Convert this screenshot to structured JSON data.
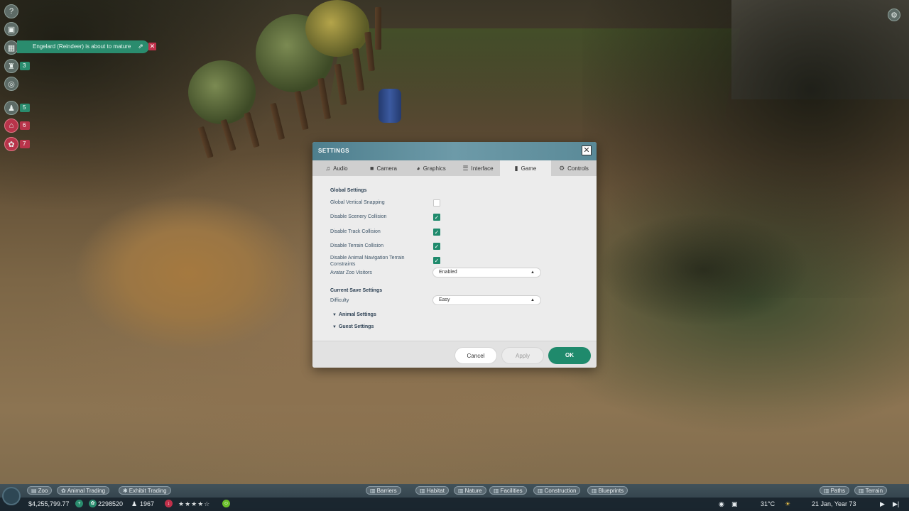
{
  "notification": {
    "text": "Engelard (Reindeer) is about to mature",
    "open_icon": "external-link-icon",
    "close_icon": "close-icon"
  },
  "left_toolbar": {
    "items": [
      {
        "icon": "help-icon",
        "glyph": "?",
        "badge": ""
      },
      {
        "icon": "zoo-icon",
        "glyph": "▣",
        "badge": ""
      },
      {
        "icon": "calendar-icon",
        "glyph": "▦",
        "badge": ""
      },
      {
        "icon": "trophy-icon",
        "glyph": "♜",
        "badge": "3"
      },
      {
        "icon": "gear-disabled-icon",
        "glyph": "◎",
        "badge": ""
      },
      {
        "icon": "staff-icon",
        "glyph": "♟",
        "badge": "5"
      },
      {
        "icon": "facility-alert-icon",
        "glyph": "⌂",
        "badge": "6"
      },
      {
        "icon": "animal-alert-icon",
        "glyph": "✿",
        "badge": "7"
      }
    ]
  },
  "dialog": {
    "title": "SETTINGS",
    "close_label": "✕",
    "tabs": [
      {
        "icon": "music-note-icon",
        "glyph": "♫",
        "label": "Audio",
        "active": false
      },
      {
        "icon": "camera-icon",
        "glyph": "■",
        "label": "Camera",
        "active": false
      },
      {
        "icon": "palette-icon",
        "glyph": "◕",
        "label": "Graphics",
        "active": false
      },
      {
        "icon": "list-icon",
        "glyph": "☰",
        "label": "Interface",
        "active": false
      },
      {
        "icon": "bar-chart-icon",
        "glyph": "▮",
        "label": "Game",
        "active": true
      },
      {
        "icon": "gear-icon",
        "glyph": "⚙",
        "label": "Controls",
        "active": false
      }
    ],
    "global_settings": {
      "title": "Global Settings",
      "rows": [
        {
          "label": "Global Vertical Snapping",
          "checked": false
        },
        {
          "label": "Disable Scenery Collision",
          "checked": true
        },
        {
          "label": "Disable Track Collision",
          "checked": true
        },
        {
          "label": "Disable Terrain Collision",
          "checked": true
        },
        {
          "label": "Disable Animal Navigation Terrain Constraints",
          "checked": true
        }
      ],
      "avatar_label": "Avatar Zoo Visitors",
      "avatar_value": "Enabled"
    },
    "current_save": {
      "title": "Current Save Settings",
      "difficulty_label": "Difficulty",
      "difficulty_value": "Easy",
      "animal_settings": "Animal Settings",
      "guest_settings": "Guest Settings"
    },
    "buttons": {
      "cancel": "Cancel",
      "apply": "Apply",
      "ok": "OK"
    }
  },
  "bottom_bar": {
    "left_tabs": [
      {
        "icon": "zoo-icon",
        "glyph": "▤",
        "label": "Zoo"
      },
      {
        "icon": "paw-icon",
        "glyph": "✿",
        "label": "Animal Trading"
      },
      {
        "icon": "exhibit-icon",
        "glyph": "✱",
        "label": "Exhibit Trading"
      }
    ],
    "center_tabs": [
      {
        "icon": "barrier-icon",
        "glyph": "▥",
        "label": "Barriers"
      },
      {
        "icon": "habitat-icon",
        "glyph": "▥",
        "label": "Habitat"
      },
      {
        "icon": "nature-icon",
        "glyph": "▥",
        "label": "Nature"
      },
      {
        "icon": "facility-icon",
        "glyph": "▥",
        "label": "Facilities"
      },
      {
        "icon": "construction-icon",
        "glyph": "▥",
        "label": "Construction"
      },
      {
        "icon": "blueprint-icon",
        "glyph": "▥",
        "label": "Blueprints"
      }
    ],
    "right_tabs": [
      {
        "icon": "path-icon",
        "glyph": "▥",
        "label": "Paths"
      },
      {
        "icon": "terrain-icon",
        "glyph": "▥",
        "label": "Terrain"
      }
    ],
    "money": "$4,255,799.77",
    "conservation": "2298520",
    "guests": "1967",
    "rating_stars": "★★★★☆",
    "temperature": "31°C",
    "date": "21 Jan, Year 73"
  }
}
